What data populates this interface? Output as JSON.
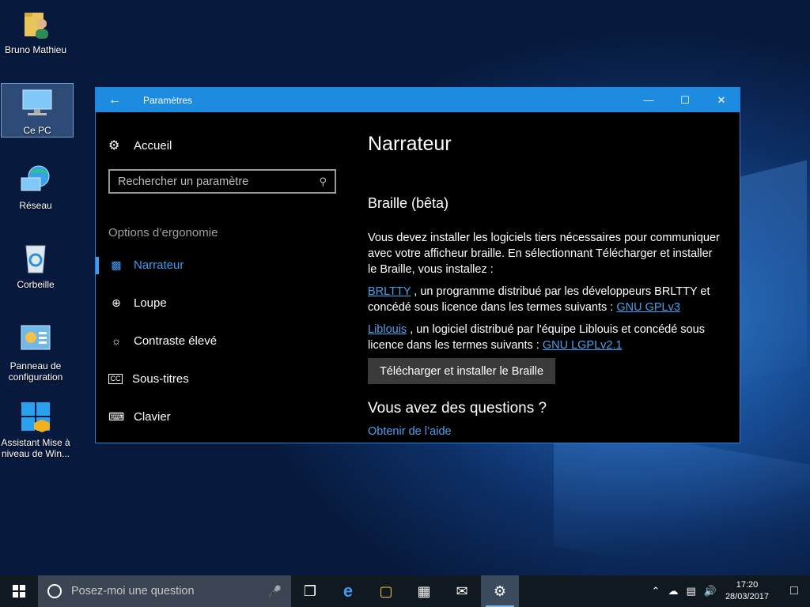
{
  "desktop": {
    "icons": [
      {
        "label": "Bruno Mathieu"
      },
      {
        "label": "Ce PC"
      },
      {
        "label": "Réseau"
      },
      {
        "label": "Corbeille"
      },
      {
        "label": "Panneau de configuration"
      },
      {
        "label": "Assistant Mise à niveau de Win..."
      }
    ]
  },
  "window": {
    "title": "Paramètres",
    "back_icon": "arrow-left-icon",
    "minimize_icon": "minimize-icon",
    "maximize_icon": "maximize-icon",
    "close_icon": "close-icon"
  },
  "sidebar": {
    "home_label": "Accueil",
    "search_placeholder": "Rechercher un paramètre",
    "section_label": "Options d’ergonomie",
    "items": [
      {
        "label": "Narrateur",
        "icon": "narrator-icon",
        "active": true
      },
      {
        "label": "Loupe",
        "icon": "magnifier-icon"
      },
      {
        "label": "Contraste élevé",
        "icon": "brightness-icon"
      },
      {
        "label": "Sous-titres",
        "icon": "closed-captions-icon"
      },
      {
        "label": "Clavier",
        "icon": "keyboard-icon"
      }
    ]
  },
  "content": {
    "title": "Narrateur",
    "section_title": "Braille (bêta)",
    "intro": "Vous devez installer les logiciels tiers nécessaires pour communiquer avec votre afficheur braille. En sélectionnant Télécharger et installer le Braille, vous installez :",
    "brltty_link": "BRLTTY",
    "brltty_text": " , un programme distribué par les développeurs BRLTTY et concédé sous licence dans les termes suivants : ",
    "brltty_license": "GNU GPLv3",
    "liblouis_link": "Liblouis",
    "liblouis_text": " , un logiciel distribué par l'équipe Liblouis et concédé sous licence dans les termes suivants : ",
    "liblouis_license": "GNU LGPLv2.1",
    "install_button": "Télécharger et installer le Braille",
    "questions_title": "Vous avez des questions ?",
    "help_link": "Obtenir de l’aide"
  },
  "taskbar": {
    "search_placeholder": "Posez-moi une question",
    "time": "17:20",
    "date": "28/03/2017"
  }
}
